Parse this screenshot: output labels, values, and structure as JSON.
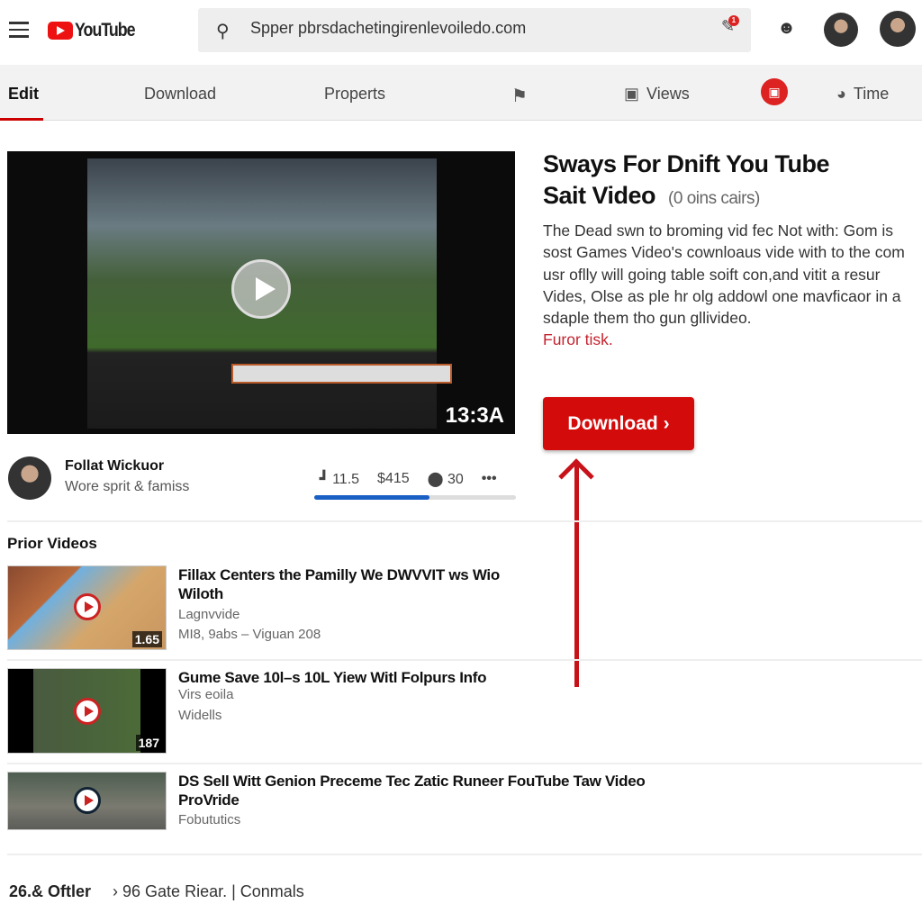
{
  "header": {
    "logo_text": "YouTube",
    "search_value": "Spper pbrsdachetingirenlevoiledo.com",
    "notification_count": "1"
  },
  "tabs": [
    {
      "label": "Edit",
      "active": true
    },
    {
      "label": "Download"
    },
    {
      "label": "Properts"
    },
    {
      "label": ""
    },
    {
      "label": "Views"
    },
    {
      "label": ""
    },
    {
      "label": "Time"
    }
  ],
  "player": {
    "duration": "13:3A"
  },
  "video": {
    "title_line1": "Sways For Dnift You Tube",
    "title_line2": "Sait Video",
    "title_note": "(0 oins cairs)",
    "description": "The Dead swn to broming vid fec Not with: Gom is sost Games Video's cownloaus vide with to the com usr oflly will going table soift con,and vitit a resur Vides, Olse as ple hr olg addowl one mavficaor in a sdaple them tho gun gllivideo.",
    "description_link": "Furor tisk.",
    "download_label": "Download ›"
  },
  "channel": {
    "name": "Follat Wickuor",
    "subtitle": "Wore sprit & famiss",
    "stat1": "11.5",
    "stat2": "$415",
    "stat3": "30",
    "progress_percent": 57
  },
  "section_title": "Prior Videos",
  "videos": [
    {
      "title": "Fillax Centers the Pamilly We DWVVIT ws Wio Wiloth",
      "meta1": "Lagnvvide",
      "meta2": "MI8, 9abs – Viguan 208",
      "duration": "1.65"
    },
    {
      "title": "Gume Save 10l–s 10L Yiew Witl Folpurs Info",
      "meta1": "Virs eoila",
      "meta2": "Widells",
      "duration": "187"
    },
    {
      "title": "DS Sell Witt Genion Preceme Tec Zatic Runeer FouTube Taw Video ProVride",
      "meta1": "Fobututics",
      "meta2": "",
      "duration": ""
    }
  ],
  "footer": {
    "left": "26.& Oftler",
    "right": "› 96 Gate Riear. | Conmals"
  },
  "colors": {
    "accent": "#d40b0b",
    "progress": "#1a5fc4"
  }
}
